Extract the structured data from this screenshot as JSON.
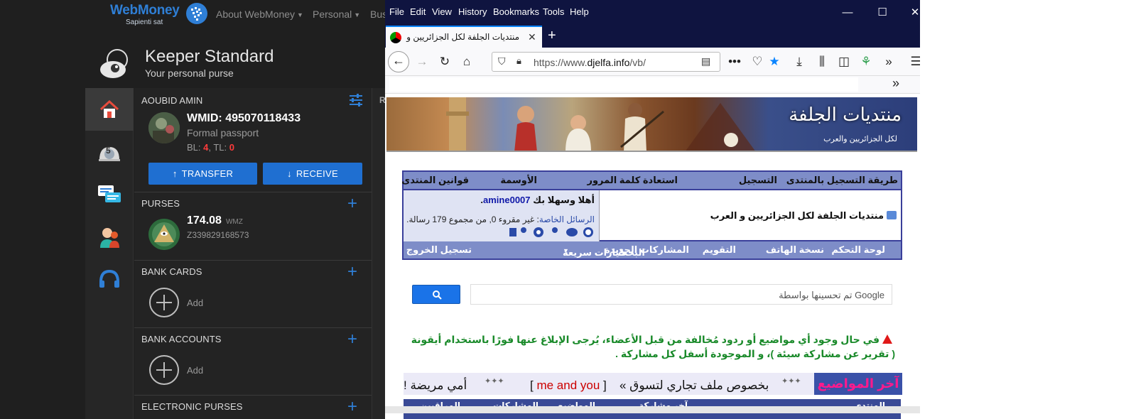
{
  "wm": {
    "brand": "WebMoney",
    "tagline": "Sapienti sat",
    "nav": {
      "about": "About WebMoney",
      "personal": "Personal",
      "business": "Bus"
    },
    "keeper_title": "Keeper Standard",
    "keeper_subtitle": "Your personal purse",
    "rail": {
      "notifications_count": "5"
    },
    "user": {
      "name": "AOUBID AMIN",
      "wmid": "WMID: 495070118433",
      "passport": "Formal passport",
      "bl_label": "BL: ",
      "bl_value": "4",
      "tl_label": ", TL: ",
      "tl_value": "0"
    },
    "buttons": {
      "transfer": "TRANSFER",
      "receive": "RECEIVE"
    },
    "purses": {
      "title": "PURSES",
      "amount": "174.08",
      "currency": "WMZ",
      "id": "Z339829168573"
    },
    "bank_cards": {
      "title": "BANK CARDS",
      "add": "Add"
    },
    "bank_accounts": {
      "title": "BANK ACCOUNTS",
      "add": "Add"
    },
    "electronic_purses": {
      "title": "ELECTRONIC PURSES"
    },
    "right_col_letter": "R"
  },
  "ff": {
    "menu": {
      "file": "File",
      "edit": "Edit",
      "view": "View",
      "history": "History",
      "bookmarks": "Bookmarks",
      "tools": "Tools",
      "help": "Help"
    },
    "tab_title": "منتديات الجلفة لكل الجزائريين و العرب",
    "url_prefix": "https://www.",
    "url_domain": "djelfa.info",
    "url_path": "/vb/",
    "page": {
      "banner_logo": "منتديات الجلفة",
      "banner_logo_sub": "لكل الجزائريين والعرب",
      "nav_top": {
        "register_method": "طريقة التسجيل بالمنتدى",
        "register": "التسجيل",
        "recover_password": "استعادة كلمة المرور",
        "medals": "الأوسمة",
        "rules": "قوانين المنتدى"
      },
      "forum_name": "منتديات الجلفة لكل الجزائريين و العرب",
      "welcome_prefix": "أهلا وسهلا بك ",
      "welcome_user": "amine0007",
      "welcome_suffix": ".",
      "pm_label": "الرسائل الخاصة",
      "pm_text": ": غير مقروء 0, من مجموع 179 رسالة.",
      "nav_bottom": {
        "control_panel": "لوحة التحكم",
        "mobile": "نسخة الهاتف",
        "calendar": "التقويم",
        "new_posts": "المشاركات الجديدة",
        "search": "البحث",
        "quick_options": "خيارات سريعة",
        "logout": "تسجيل الخروج"
      },
      "search_placeholder": "تم تحسينها بواسطة Google",
      "notice": "في حال وجود أي مواضيع أو ردود مُخالفة من قبل الأعضاء، يُرجى الإبلاغ عنها فورًا باستخدام أيقونة ( تقرير عن مشاركة سيئة )، و الموجودة أسفل كل مشاركة .",
      "latest_title": "آخر المواضيع",
      "ticker1": "بخصوص ملف تجاري لتسوق »",
      "ticker2_open": "[ ",
      "ticker2_user": "me and you",
      "ticker2_close": " ]",
      "ticker3": "أمي مريضة !",
      "bottom_headers": {
        "forum": "المنتدى",
        "last_post": "آخر مشاركة",
        "topics": "المواضيع",
        "posts": "المشاركات",
        "viewers": "المراقبين"
      }
    }
  },
  "colors": {
    "wm_bg": "#1f1f1f",
    "wm_accent": "#1f6fd1",
    "ff_titlebar": "#0f1440",
    "forum_nav": "#7e8dc8",
    "notice_green": "#1a8a2a"
  }
}
